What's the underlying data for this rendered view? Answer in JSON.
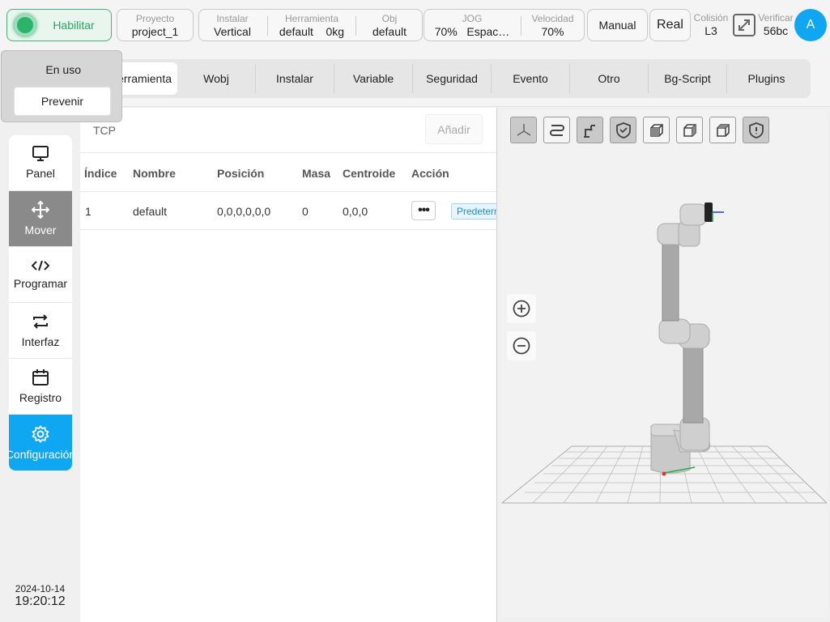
{
  "topbar": {
    "enable_label": "Habilitar",
    "project": {
      "title": "Proyecto",
      "value": "project_1"
    },
    "install": {
      "title": "Instalar",
      "value": "Vertical"
    },
    "tool": {
      "title": "Herramienta",
      "value": "default",
      "extra": "0kg"
    },
    "obj": {
      "title": "Obj",
      "value": "default"
    },
    "jog": {
      "title": "JOG",
      "value": "70%",
      "extra": "Espac…"
    },
    "speed": {
      "title": "Velocidad",
      "value": "70%"
    },
    "mode_label": "Manual",
    "real_label": "Real",
    "collision": {
      "title": "Colisión",
      "value": "L3"
    },
    "verify": {
      "title": "Verificar",
      "value": "56bc"
    },
    "avatar_letter": "A"
  },
  "popover": {
    "status": "En uso",
    "action": "Prevenir"
  },
  "sidebar": {
    "items": [
      {
        "label": "Panel"
      },
      {
        "label": "Mover"
      },
      {
        "label": "Programar"
      },
      {
        "label": "Interfaz"
      },
      {
        "label": "Registro"
      },
      {
        "label": "Configuración"
      }
    ],
    "date": "2024-10-14",
    "time": "19:20:12"
  },
  "tabs": [
    "Herramienta",
    "Wobj",
    "Instalar",
    "Variable",
    "Seguridad",
    "Evento",
    "Otro",
    "Bg-Script",
    "Plugins"
  ],
  "tcp_panel": {
    "title": "TCP",
    "add_label": "Añadir",
    "columns": [
      "Índice",
      "Nombre",
      "Posición",
      "Masa",
      "Centroide",
      "Acción"
    ],
    "rows": [
      {
        "index": "1",
        "name": "default",
        "position": "0,0,0,0,0,0",
        "mass": "0",
        "centroid": "0,0,0",
        "badge": "Predeterminado"
      }
    ]
  },
  "colors": {
    "accent": "#10a7f2",
    "enable_green": "#2bb36a"
  }
}
